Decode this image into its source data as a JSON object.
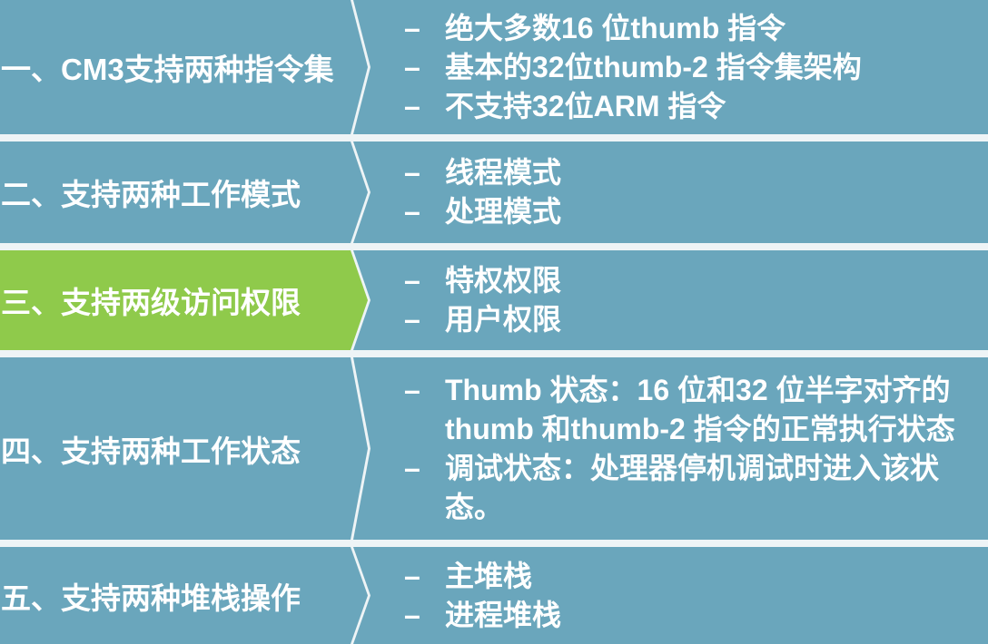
{
  "colors": {
    "panel": "#6aa6bc",
    "highlight": "#8fca4b",
    "text": "#ffffff",
    "background": "#eef4f6"
  },
  "bullet_marker": "–",
  "rows": [
    {
      "label": "一、CM3支持两种指令集",
      "active": false,
      "bullets": [
        "绝大多数16 位thumb 指令",
        "基本的32位thumb-2 指令集架构",
        "不支持32位ARM 指令"
      ]
    },
    {
      "label": "二、支持两种工作模式",
      "active": false,
      "bullets": [
        "线程模式",
        "处理模式"
      ]
    },
    {
      "label": "三、支持两级访问权限",
      "active": true,
      "bullets": [
        "特权权限",
        "用户权限"
      ]
    },
    {
      "label": "四、支持两种工作状态",
      "active": false,
      "bullets": [
        "Thumb 状态：16 位和32 位半字对齐的thumb 和thumb-2 指令的正常执行状态",
        "调试状态：处理器停机调试时进入该状态。"
      ]
    },
    {
      "label": "五、支持两种堆栈操作",
      "active": false,
      "bullets": [
        "主堆栈",
        "进程堆栈"
      ]
    }
  ]
}
